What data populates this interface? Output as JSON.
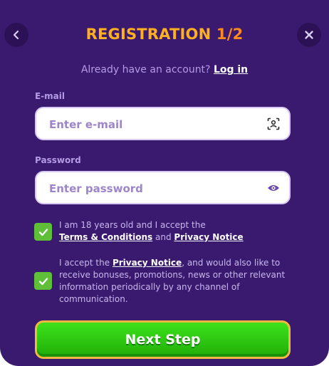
{
  "header": {
    "title_main": "REGISTRATION ",
    "title_step": "1/2",
    "back_icon": "chevron-left-icon",
    "close_icon": "close-icon"
  },
  "login_prompt": {
    "text": "Already have an account? ",
    "link": "Log in"
  },
  "email": {
    "label": "E-mail",
    "placeholder": "Enter e-mail",
    "value": "",
    "icon": "face-scan-icon"
  },
  "password": {
    "label": "Password",
    "placeholder": "Enter password",
    "value": "",
    "icon": "eye-icon"
  },
  "consent_age": {
    "checked": true,
    "text_1": "I am 18 years old and I accept the",
    "terms_link": "Terms & Conditions",
    "text_and": " and ",
    "privacy_link": "Privacy Notice"
  },
  "consent_marketing": {
    "checked": true,
    "text_1": "I accept the ",
    "privacy_link": "Privacy Notice",
    "text_2": ", and would also like to receive bonuses, promotions, news or other relevant information periodically by any channel of communication."
  },
  "submit": {
    "label": "Next Step"
  },
  "colors": {
    "background": "#3a1a6e",
    "title": "#ffb020",
    "button_green": "#2fcf12",
    "button_border": "#f2b842",
    "checkbox": "#5fbf38"
  }
}
